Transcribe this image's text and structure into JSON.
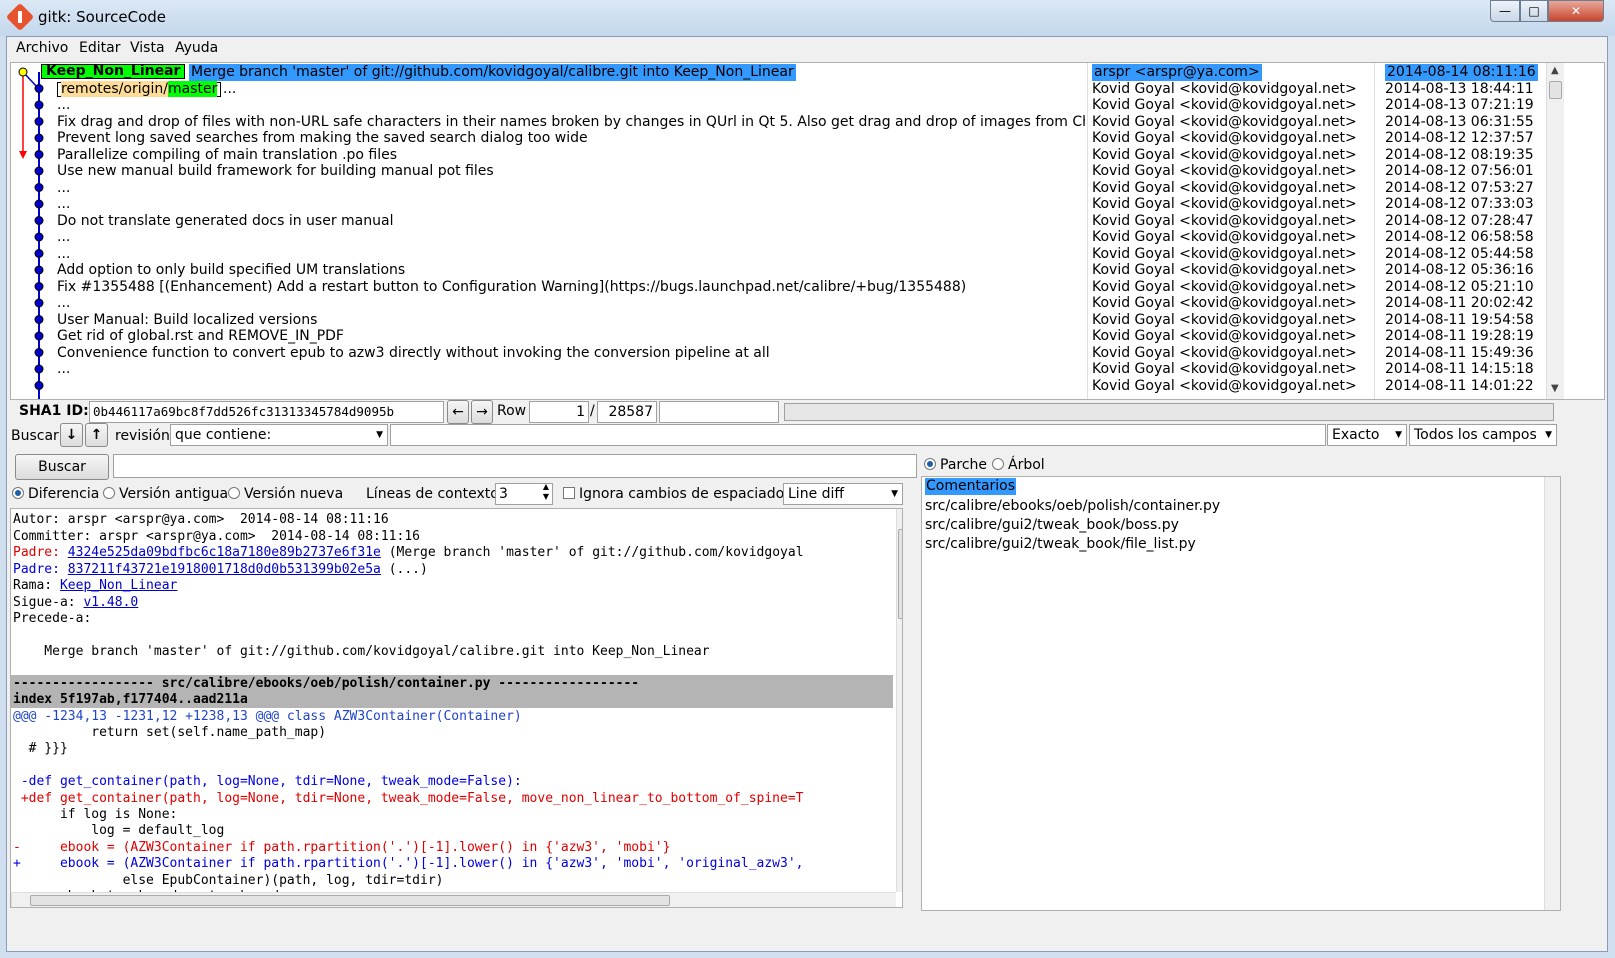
{
  "window": {
    "title": "gitk: SourceCode",
    "min": "—",
    "max": "□",
    "close": "✕"
  },
  "menu": [
    "Archivo",
    "Editar",
    "Vista",
    "Ayuda"
  ],
  "history": {
    "refs": {
      "head_branch": "Keep_Non_Linear",
      "remote_prefix": "remotes/origin/",
      "remote_branch": "master"
    },
    "commits": [
      "Merge branch 'master' of git://github.com/kovidgoyal/calibre.git into Keep_Non_Linear",
      "...",
      "...",
      "Fix drag and drop of files with non-URL safe characters in their names broken by changes in QUrl in Qt 5. Also get drag and drop of images from Chromium on linux",
      "Prevent long saved searches from making the saved search dialog too wide",
      "Parallelize compiling of main translation .po files",
      "Use new manual build framework for building manual pot files",
      "...",
      "...",
      "Do not translate generated docs in user manual",
      "...",
      "...",
      "Add option to only build specified UM translations",
      "Fix #1355488 [(Enhancement) Add a restart button to Configuration Warning](https://bugs.launchpad.net/calibre/+bug/1355488)",
      "...",
      "User Manual: Build localized versions",
      "Get rid of global.rst and REMOVE_IN_PDF",
      "Convenience function to convert epub to azw3 directly without invoking the conversion pipeline at all",
      "...",
      ""
    ],
    "authors": [
      "arspr <arspr@ya.com>",
      "Kovid Goyal <kovid@kovidgoyal.net>",
      "Kovid Goyal <kovid@kovidgoyal.net>",
      "Kovid Goyal <kovid@kovidgoyal.net>",
      "Kovid Goyal <kovid@kovidgoyal.net>",
      "Kovid Goyal <kovid@kovidgoyal.net>",
      "Kovid Goyal <kovid@kovidgoyal.net>",
      "Kovid Goyal <kovid@kovidgoyal.net>",
      "Kovid Goyal <kovid@kovidgoyal.net>",
      "Kovid Goyal <kovid@kovidgoyal.net>",
      "Kovid Goyal <kovid@kovidgoyal.net>",
      "Kovid Goyal <kovid@kovidgoyal.net>",
      "Kovid Goyal <kovid@kovidgoyal.net>",
      "Kovid Goyal <kovid@kovidgoyal.net>",
      "Kovid Goyal <kovid@kovidgoyal.net>",
      "Kovid Goyal <kovid@kovidgoyal.net>",
      "Kovid Goyal <kovid@kovidgoyal.net>",
      "Kovid Goyal <kovid@kovidgoyal.net>",
      "Kovid Goyal <kovid@kovidgoyal.net>",
      "Kovid Goyal <kovid@kovidgoyal.net>"
    ],
    "dates": [
      "2014-08-14 08:11:16",
      "2014-08-13 18:44:11",
      "2014-08-13 07:21:19",
      "2014-08-13 06:31:55",
      "2014-08-12 12:37:57",
      "2014-08-12 08:19:35",
      "2014-08-12 07:56:01",
      "2014-08-12 07:53:27",
      "2014-08-12 07:33:03",
      "2014-08-12 07:28:47",
      "2014-08-12 06:58:58",
      "2014-08-12 05:44:58",
      "2014-08-12 05:36:16",
      "2014-08-12 05:21:10",
      "2014-08-11 20:02:42",
      "2014-08-11 19:54:58",
      "2014-08-11 19:28:19",
      "2014-08-11 15:49:36",
      "2014-08-11 14:15:18",
      "2014-08-11 14:01:22"
    ]
  },
  "sha": {
    "label": "SHA1 ID:",
    "value": "0b446117a69bc8f7dd526fc31313345784d9095b",
    "row_label": "Row",
    "row_current": "1",
    "row_sep": "/",
    "row_total": "28587"
  },
  "search": {
    "label": "Buscar",
    "down": "↓",
    "up": "↑",
    "type": "revisión",
    "mode": "que contiene:",
    "match": "Exacto",
    "fields": "Todos los campos",
    "button": "Buscar"
  },
  "view_options": {
    "diff": "Diferencia",
    "old": "Versión antigua",
    "new": "Versión nueva",
    "context_label": "Líneas de contexto:",
    "context_value": "3",
    "ignore_ws": "Ignora cambios de espaciado",
    "diff_mode": "Line diff"
  },
  "diff": {
    "author": "Autor: arspr <arspr@ya.com>  2014-08-14 08:11:16",
    "committer": "Committer: arspr <arspr@ya.com>  2014-08-14 08:11:16",
    "parent1_label": "Padre: ",
    "parent1_hash": "4324e525da09bdfbc6c18a7180e89b2737e6f31e",
    "parent1_desc": " (Merge branch 'master' of git://github.com/kovidgoyal",
    "parent2_label": "Padre: ",
    "parent2_hash": "837211f43721e1918001718d0d0b531399b02e5a",
    "parent2_desc": " (...)",
    "branch_label": "Rama: ",
    "branch": "Keep_Non_Linear",
    "follows_label": "Sigue-a: ",
    "follows": "v1.48.0",
    "precedes": "Precede-a:",
    "message": "    Merge branch 'master' of git://github.com/kovidgoyal/calibre.git into Keep_Non_Linear",
    "file_header": "------------------ src/calibre/ebooks/oeb/polish/container.py ------------------",
    "index": "index 5f197ab,f177404..aad211a",
    "hunk": "@@@ -1234,13 -1231,12 +1238,13 @@@ class AZW3Container(Container)",
    "lines": [
      {
        "t": "          return set(self.name_path_map)",
        "c": ""
      },
      {
        "t": "  # }}}",
        "c": ""
      },
      {
        "t": "",
        "c": ""
      },
      {
        "t": " -def get_container(path, log=None, tdir=None, tweak_mode=False):",
        "c": "blue"
      },
      {
        "t": " +def get_container(path, log=None, tdir=None, tweak_mode=False, move_non_linear_to_bottom_of_spine=T",
        "c": "red"
      },
      {
        "t": "      if log is None:",
        "c": ""
      },
      {
        "t": "          log = default_log",
        "c": ""
      },
      {
        "t": "-     ebook = (AZW3Container if path.rpartition('.')[-1].lower() in {'azw3', 'mobi'}",
        "c": "red"
      },
      {
        "t": "+     ebook = (AZW3Container if path.rpartition('.')[-1].lower() in {'azw3', 'mobi', 'original_azw3',",
        "c": "blue"
      },
      {
        "t": "              else EpubContainer)(path, log, tdir=tdir)",
        "c": ""
      },
      {
        "t": "      ebook.tweak_mode = tweak_mode",
        "c": ""
      }
    ]
  },
  "files": {
    "patch": "Parche",
    "tree": "Árbol",
    "items": [
      "Comentarios",
      "src/calibre/ebooks/oeb/polish/container.py",
      "src/calibre/gui2/tweak_book/boss.py",
      "src/calibre/gui2/tweak_book/file_list.py"
    ]
  },
  "colors": {
    "selection": "#3399ff",
    "branch_green": "#00ff00",
    "graph_blue": "#0000cc",
    "graph_red": "#ff0000"
  }
}
